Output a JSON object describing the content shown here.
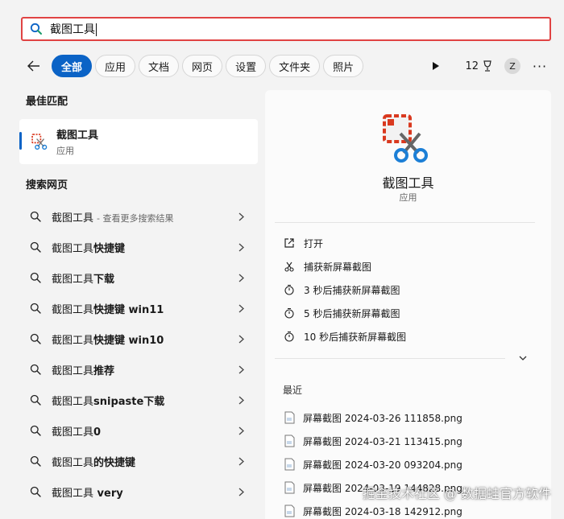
{
  "search": {
    "query": "截图工具"
  },
  "filters": {
    "items": [
      "全部",
      "应用",
      "文档",
      "网页",
      "设置",
      "文件夹",
      "照片"
    ],
    "points": "12"
  },
  "avatar_letter": "Z",
  "best_match": {
    "heading": "最佳匹配",
    "title": "截图工具",
    "subtitle": "应用"
  },
  "web": {
    "heading": "搜索网页",
    "items": [
      {
        "query": "截图工具",
        "bold": "",
        "hint": "- 查看更多搜索结果"
      },
      {
        "query": "截图工具",
        "bold": "快捷键",
        "hint": ""
      },
      {
        "query": "截图工具",
        "bold": "下载",
        "hint": ""
      },
      {
        "query": "截图工具",
        "bold": "快捷键 win11",
        "hint": ""
      },
      {
        "query": "截图工具",
        "bold": "快捷键 win10",
        "hint": ""
      },
      {
        "query": "截图工具",
        "bold": "推荐",
        "hint": ""
      },
      {
        "query": "截图工具",
        "bold": "snipaste下载",
        "hint": ""
      },
      {
        "query": "截图工具",
        "bold": "0",
        "hint": ""
      },
      {
        "query": "截图工具",
        "bold": "的快捷键",
        "hint": ""
      },
      {
        "query": "截图工具",
        "bold": " very",
        "hint": ""
      }
    ]
  },
  "detail": {
    "app_name": "截图工具",
    "app_type": "应用",
    "actions": [
      "打开",
      "捕获新屏幕截图",
      "3 秒后捕获新屏幕截图",
      "5 秒后捕获新屏幕截图",
      "10 秒后捕获新屏幕截图"
    ],
    "recent_heading": "最近",
    "recent_files": [
      "屏幕截图 2024-03-26 111858.png",
      "屏幕截图 2024-03-21 113415.png",
      "屏幕截图 2024-03-20 093204.png",
      "屏幕截图 2024-03-19 144828.png",
      "屏幕截图 2024-03-18 142912.png"
    ]
  },
  "watermark": "掘金技术社区 @ 数据蛙官方软件",
  "colors": {
    "accent": "#0b63c6",
    "focus_border": "#e04343",
    "snip_red": "#d9391f",
    "snip_blue": "#1c7fd6"
  }
}
